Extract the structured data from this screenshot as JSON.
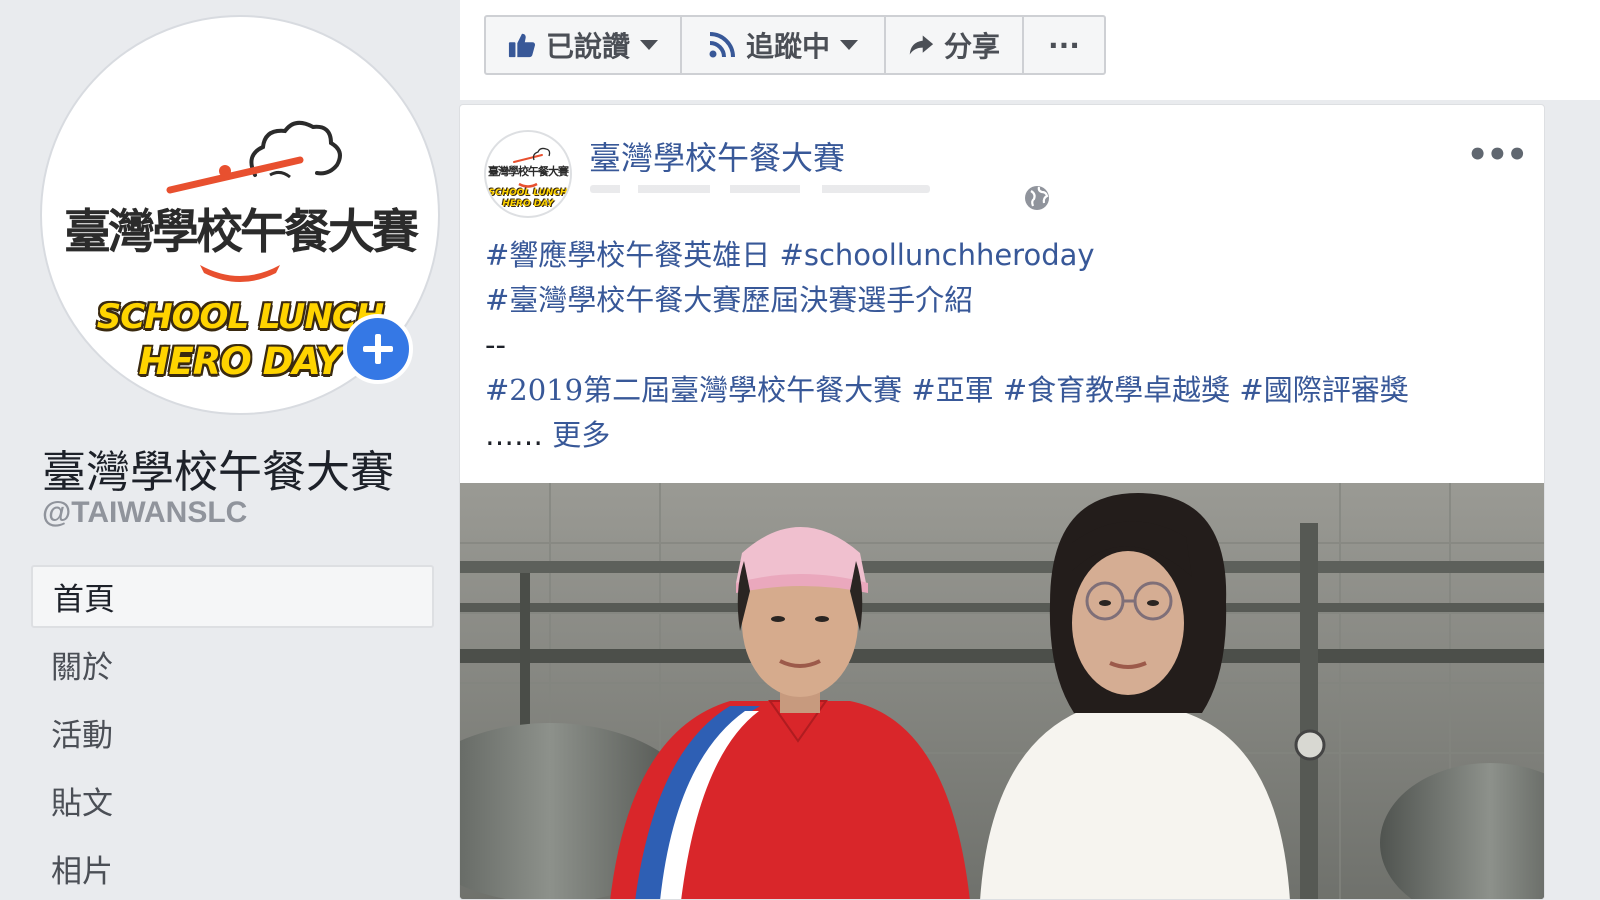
{
  "page": {
    "logo": {
      "title": "臺灣學校午餐大賽",
      "line1": "SCHOOL LUNCH",
      "line2": "HERO DAY"
    },
    "name": "臺灣學校午餐大賽",
    "handle": "@TAIWANSLC",
    "add_icon": "plus-icon"
  },
  "nav": {
    "items": [
      {
        "label": "首頁",
        "active": true
      },
      {
        "label": "關於"
      },
      {
        "label": "活動"
      },
      {
        "label": "貼文"
      },
      {
        "label": "相片"
      }
    ]
  },
  "actions": {
    "like_label": "已說讚",
    "follow_label": "追蹤中",
    "share_label": "分享",
    "more_label": "···",
    "like_icon": "thumbs-up-icon",
    "follow_icon": "rss-icon",
    "share_icon": "share-arrow-icon"
  },
  "post": {
    "author": "臺灣學校午餐大賽",
    "privacy_icon": "globe-icon",
    "options_label": "•••",
    "line1": {
      "tag1": "#響應學校午餐英雄日",
      "tag2": "#schoollunchheroday"
    },
    "line2": {
      "tag": "#臺灣學校午餐大賽歷屆決賽選手介紹"
    },
    "line3": {
      "text": "--"
    },
    "line4": {
      "tag1": "#2019第二屆臺灣學校午餐大賽",
      "tag2": "#亞軍",
      "tag3": "#食育教學卓越獎",
      "tag4": "#國際評審獎"
    },
    "line5": {
      "ellipsis": "……",
      "more": "更多"
    }
  },
  "colors": {
    "background": "#e9ebee",
    "link": "#385898",
    "accent": "#3578e5",
    "logo_red": "#e8502f",
    "logo_yellow": "#ffd400"
  }
}
